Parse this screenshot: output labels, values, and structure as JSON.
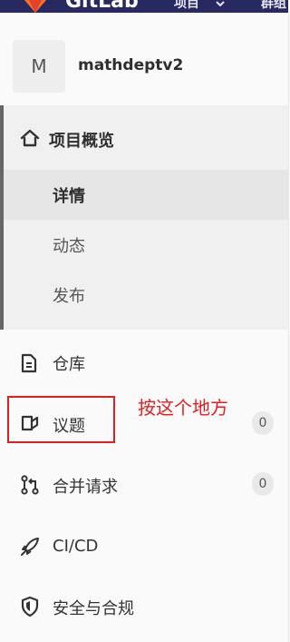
{
  "topbar": {
    "brand": "GitLab",
    "menu_projects": "项目",
    "menu_groups": "群组"
  },
  "project": {
    "avatar_letter": "M",
    "name": "mathdeptv2"
  },
  "nav": {
    "overview": {
      "label": "项目概览",
      "icon": "home-icon",
      "children": [
        {
          "label": "详情",
          "active": true
        },
        {
          "label": "动态",
          "active": false
        },
        {
          "label": "发布",
          "active": false
        }
      ]
    },
    "items": [
      {
        "label": "仓库",
        "icon": "file-icon"
      },
      {
        "label": "议题",
        "icon": "issues-icon",
        "count": "0"
      },
      {
        "label": "合并请求",
        "icon": "merge-request-icon",
        "count": "0"
      },
      {
        "label": "CI/CD",
        "icon": "rocket-icon"
      },
      {
        "label": "安全与合规",
        "icon": "shield-icon"
      }
    ]
  },
  "annotation": {
    "text": "按这个地方",
    "color": "#e02020"
  }
}
